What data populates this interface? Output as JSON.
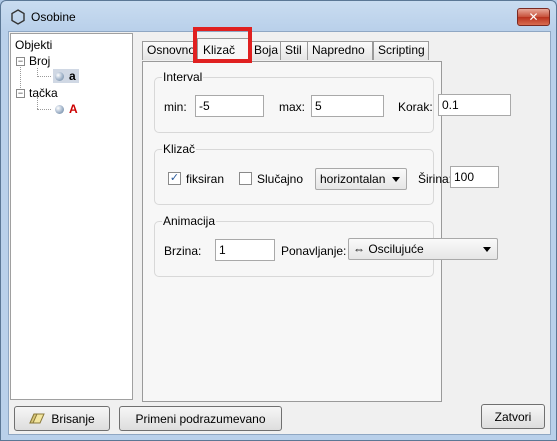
{
  "window": {
    "title": "Osobine",
    "close_glyph": "✕",
    "icon": "hexagon-outline-icon"
  },
  "tree": {
    "root_label": "Objekti",
    "groups": [
      {
        "label": "Broj",
        "toggle": "−",
        "items": [
          {
            "label": "a",
            "color": "#000000",
            "selected": true
          }
        ]
      },
      {
        "label": "tačka",
        "toggle": "−",
        "items": [
          {
            "label": "A",
            "color": "#cc0000",
            "selected": false
          }
        ]
      }
    ]
  },
  "tabs": [
    "Osnovno",
    "Klizač",
    "Boja",
    "Stil",
    "Napredno",
    "Scripting"
  ],
  "active_tab": "Klizač",
  "highlight_color": "#e02020",
  "interval": {
    "title": "Interval",
    "min_label": "min:",
    "min_value": "-5",
    "max_label": "max:",
    "max_value": "5",
    "step_label": "Korak:",
    "step_value": "0.1"
  },
  "slider": {
    "title": "Klizač",
    "fixed_label": "fiksiran",
    "fixed_checked": true,
    "random_label": "Slučajno",
    "random_checked": false,
    "orientation": "horizontalan",
    "width_label": "Širina:",
    "width_value": "100"
  },
  "animation": {
    "title": "Animacija",
    "speed_label": "Brzina:",
    "speed_value": "1",
    "repeat_label": "Ponavljanje:",
    "repeat_value": "⇔ Oscilujuće"
  },
  "buttons": {
    "delete": "Brisanje",
    "apply_default": "Primeni podrazumevano",
    "close": "Zatvori"
  },
  "check_glyph": "✓"
}
